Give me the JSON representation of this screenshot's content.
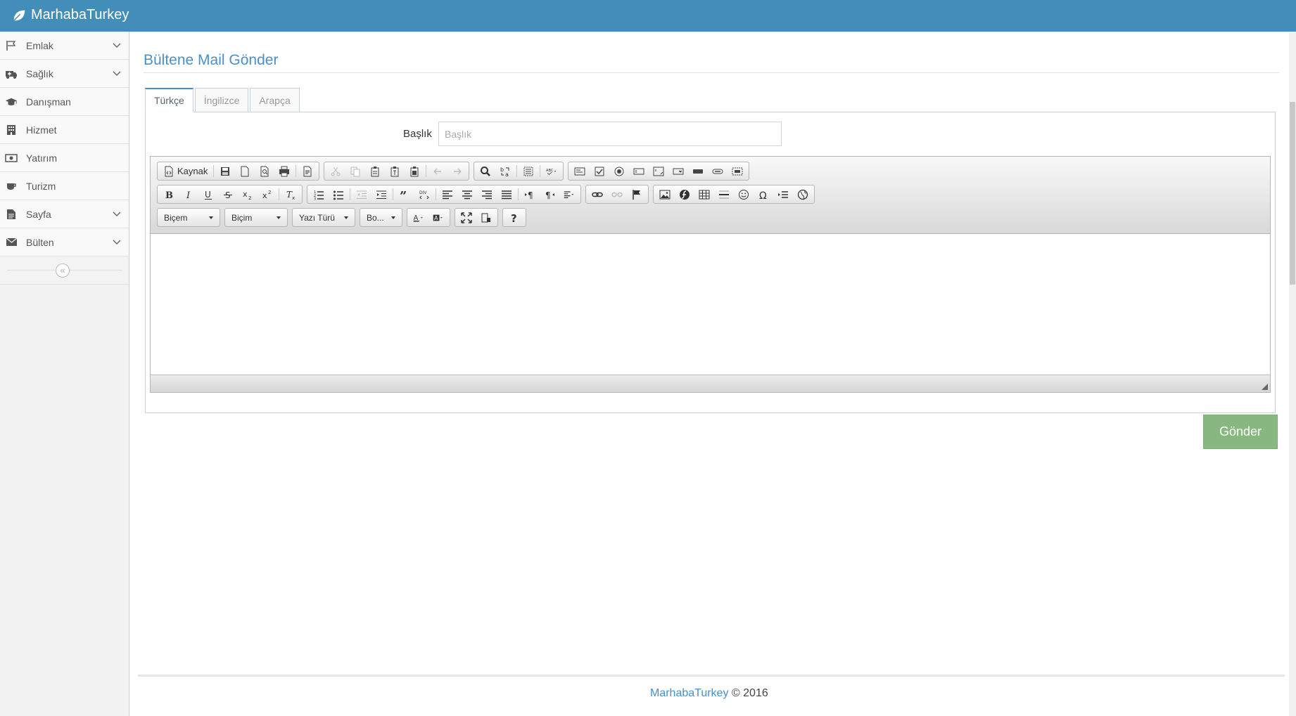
{
  "app": {
    "brand": "MarhabaTurkey"
  },
  "sidebar": {
    "items": [
      {
        "label": "Emlak",
        "icon": "flag-icon",
        "expandable": true
      },
      {
        "label": "Sağlık",
        "icon": "ambulance-icon",
        "expandable": true
      },
      {
        "label": "Danışman",
        "icon": "graduation-cap-icon",
        "expandable": false
      },
      {
        "label": "Hizmet",
        "icon": "building-icon",
        "expandable": false
      },
      {
        "label": "Yatırım",
        "icon": "money-icon",
        "expandable": false
      },
      {
        "label": "Turizm",
        "icon": "coffee-icon",
        "expandable": false
      },
      {
        "label": "Sayfa",
        "icon": "file-icon",
        "expandable": true
      },
      {
        "label": "Bülten",
        "icon": "envelope-icon",
        "expandable": true
      }
    ],
    "collapse_glyph": "«"
  },
  "main": {
    "title": "Bültene Mail Gönder",
    "tabs": [
      {
        "label": "Türkçe",
        "active": true
      },
      {
        "label": "İngilizce",
        "active": false
      },
      {
        "label": "Arapça",
        "active": false
      }
    ],
    "form": {
      "title_label": "Başlık",
      "title_placeholder": "Başlık",
      "title_value": ""
    },
    "editor": {
      "source_label": "Kaynak",
      "combos": [
        "Biçem",
        "Biçim",
        "Yazı Türü",
        "Bo..."
      ]
    },
    "send_label": "Gönder"
  },
  "footer": {
    "brand": "MarhabaTurkey",
    "copyright": "© 2016"
  },
  "colors": {
    "navbar": "#438eb9",
    "accent": "#4a90c7",
    "send": "#87b87f"
  }
}
